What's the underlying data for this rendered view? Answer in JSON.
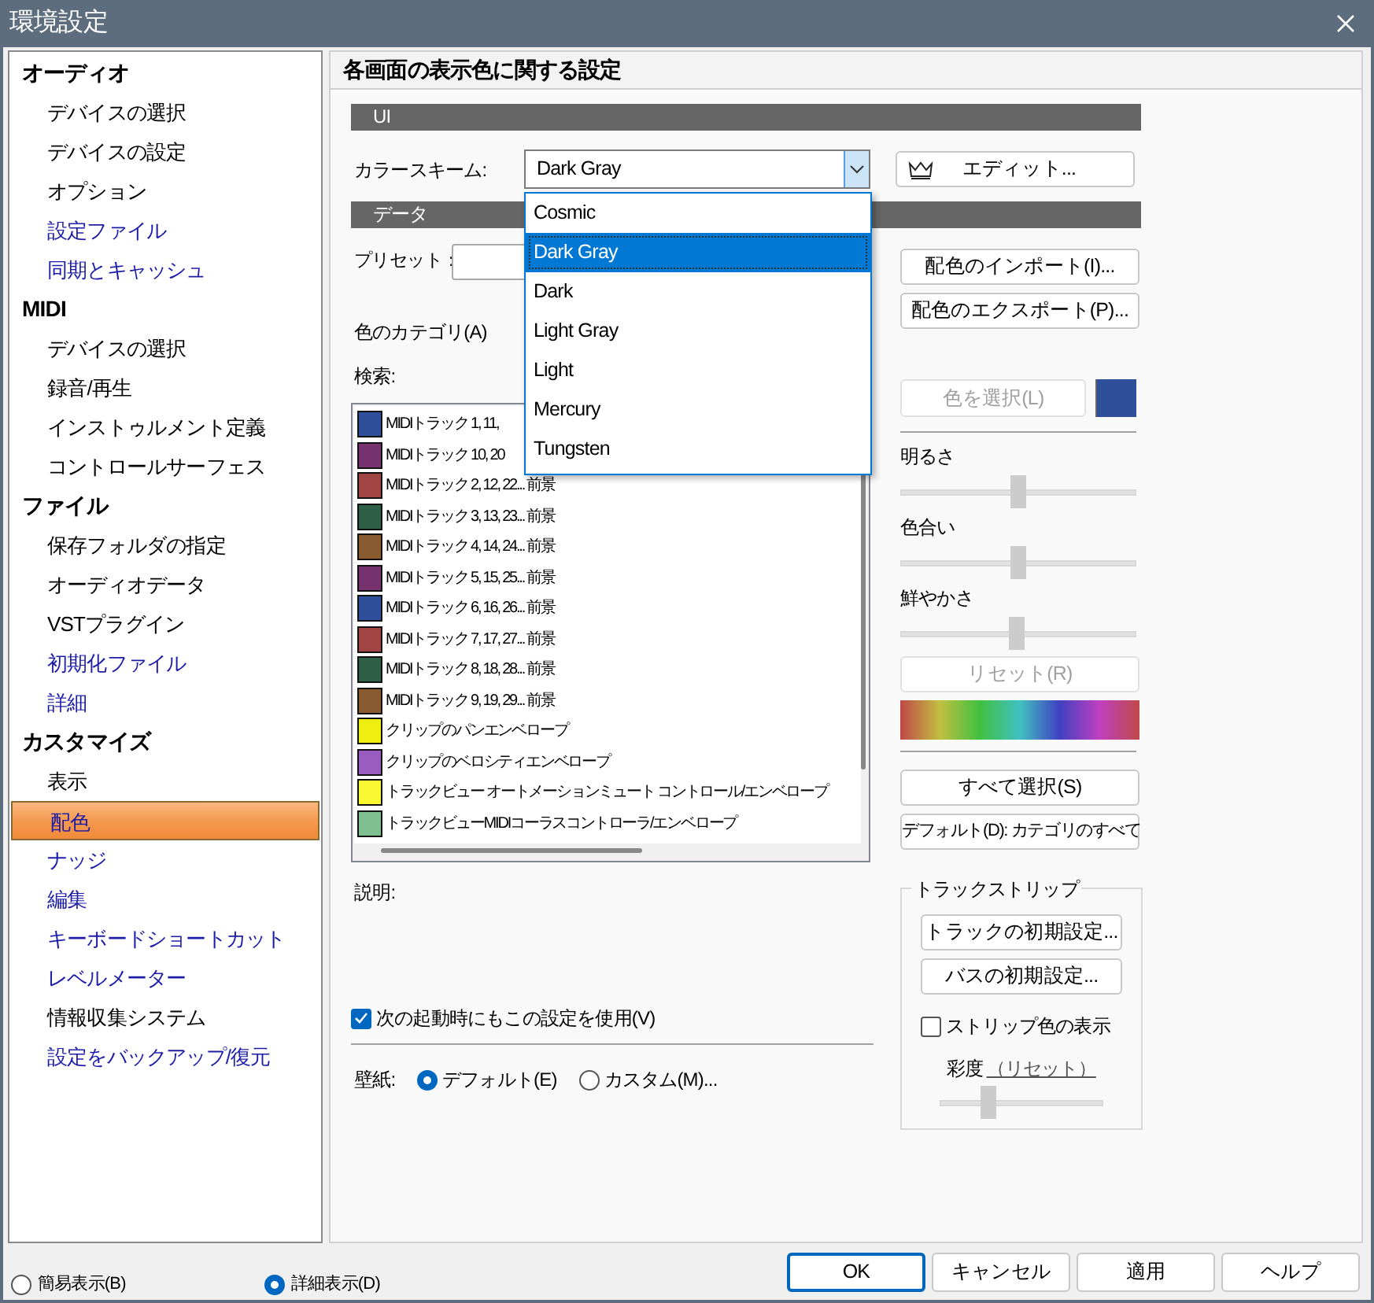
{
  "window": {
    "title": "環境設定"
  },
  "sidebar": {
    "groups": [
      {
        "label": "オーディオ",
        "items": [
          {
            "label": "デバイスの選択",
            "selected": false,
            "color": "#000000"
          },
          {
            "label": "デバイスの設定",
            "selected": false,
            "color": "#000000"
          },
          {
            "label": "オプション",
            "selected": false,
            "color": "#000000"
          },
          {
            "label": "設定ファイル",
            "selected": false,
            "color": "#1c1ca8"
          },
          {
            "label": "同期とキャッシュ",
            "selected": false,
            "color": "#1c1ca8"
          }
        ]
      },
      {
        "label": "MIDI",
        "items": [
          {
            "label": "デバイスの選択",
            "selected": false,
            "color": "#000000"
          },
          {
            "label": "録音/再生",
            "selected": false,
            "color": "#000000"
          },
          {
            "label": "インストゥルメント定義",
            "selected": false,
            "color": "#000000"
          },
          {
            "label": "コントロールサーフェス",
            "selected": false,
            "color": "#000000"
          }
        ]
      },
      {
        "label": "ファイル",
        "items": [
          {
            "label": "保存フォルダの指定",
            "selected": false,
            "color": "#000000"
          },
          {
            "label": "オーディオデータ",
            "selected": false,
            "color": "#000000"
          },
          {
            "label": "VSTプラグイン",
            "selected": false,
            "color": "#000000"
          },
          {
            "label": "初期化ファイル",
            "selected": false,
            "color": "#1c1ca8"
          },
          {
            "label": "詳細",
            "selected": false,
            "color": "#1c1ca8"
          }
        ]
      },
      {
        "label": "カスタマイズ",
        "items": [
          {
            "label": "表示",
            "selected": false,
            "color": "#000000"
          },
          {
            "label": "配色",
            "selected": true,
            "color": "#1c1ca8"
          },
          {
            "label": "ナッジ",
            "selected": false,
            "color": "#1c1ca8"
          },
          {
            "label": "編集",
            "selected": false,
            "color": "#1c1ca8"
          },
          {
            "label": "キーボードショートカット",
            "selected": false,
            "color": "#1c1ca8"
          },
          {
            "label": "レベルメーター",
            "selected": false,
            "color": "#1c1ca8"
          },
          {
            "label": "情報収集システム",
            "selected": false,
            "color": "#000000"
          },
          {
            "label": "設定をバックアップ/復元",
            "selected": false,
            "color": "#1c1ca8"
          }
        ]
      }
    ]
  },
  "panel": {
    "title": "各画面の表示色に関する設定",
    "ui_section": {
      "title": "UI",
      "color_scheme": {
        "label": "カラースキーム:",
        "value": "Dark Gray",
        "expanded": true,
        "options": [
          {
            "label": "Cosmic",
            "selected": false
          },
          {
            "label": "Dark Gray",
            "selected": true
          },
          {
            "label": "Dark",
            "selected": false
          },
          {
            "label": "Light Gray",
            "selected": false
          },
          {
            "label": "Light",
            "selected": false
          },
          {
            "label": "Mercury",
            "selected": false
          },
          {
            "label": "Tungsten",
            "selected": false
          }
        ]
      },
      "edit_button": "エディット..."
    },
    "data_section": {
      "title": "データ",
      "preset_label": "プリセット：",
      "import_button": "配色のインポート(I)...",
      "export_button": "配色のエクスポート(P)...",
      "category_label": "色のカテゴリ(A)",
      "search_label": "検索:",
      "color_items": [
        {
          "label": "MIDIトラック 1, 11,",
          "color": "#2f4f9a"
        },
        {
          "label": "MIDIトラック 10, 20",
          "color": "#773370"
        },
        {
          "label": "MIDIトラック 2, 12, 22... 前景",
          "color": "#a04444"
        },
        {
          "label": "MIDIトラック 3, 13, 23... 前景",
          "color": "#2e6048"
        },
        {
          "label": "MIDIトラック 4, 14, 24... 前景",
          "color": "#8a5a30"
        },
        {
          "label": "MIDIトラック 5, 15, 25... 前景",
          "color": "#773370"
        },
        {
          "label": "MIDIトラック 6, 16, 26... 前景",
          "color": "#2f4f9a"
        },
        {
          "label": "MIDIトラック 7, 17, 27... 前景",
          "color": "#a04444"
        },
        {
          "label": "MIDIトラック 8, 18, 28... 前景",
          "color": "#2e6048"
        },
        {
          "label": "MIDIトラック 9, 19, 29... 前景",
          "color": "#8a5a30"
        },
        {
          "label": "クリップのパンエンベロープ",
          "color": "#eeee10"
        },
        {
          "label": "クリップのベロシティエンベロープ",
          "color": "#9a5cc0"
        },
        {
          "label": "トラックビュー オートメーションミュート コントロール/エンベロープ",
          "color": "#f8f830"
        },
        {
          "label": "トラックビューMIDIコーラスコントローラ/エンベロープ",
          "color": "#80c090"
        }
      ],
      "pick_color_button": {
        "label": "色を選択(L)",
        "disabled": true
      },
      "adjustments": [
        {
          "label": "明るさ",
          "level": 0.5
        },
        {
          "label": "色合い",
          "level": 0.5
        },
        {
          "label": "鮮やかさ",
          "level": 0.49
        }
      ],
      "reset_button": {
        "label": "リセット(R)",
        "disabled": true
      },
      "select_all_button": "すべて選択(S)",
      "default_button": "デフォルト(D): カテゴリのすべて",
      "description_label": "説明:",
      "use_on_startup": {
        "label": "次の起動時にもこの設定を使用(V)",
        "checked": true
      },
      "wallpaper": {
        "label": "壁紙:",
        "options": [
          {
            "label": "デフォルト(E)",
            "selected": true
          },
          {
            "label": "カスタム(M)...",
            "selected": false
          }
        ]
      },
      "track_strip": {
        "title": "トラックストリップ",
        "buttons": [
          "トラックの初期設定...",
          "バスの初期設定..."
        ],
        "show_strip_color": {
          "label": "ストリップ色の表示",
          "checked": false
        },
        "saturation_label": "彩度",
        "saturation_reset": "（リセット）",
        "saturation": {
          "level": 0.3
        }
      }
    }
  },
  "footer": {
    "view_modes": [
      {
        "label": "簡易表示(B)",
        "selected": false
      },
      {
        "label": "詳細表示(D)",
        "selected": true
      }
    ],
    "buttons": [
      {
        "label": "OK",
        "default": true
      },
      {
        "label": "キャンセル",
        "default": false
      },
      {
        "label": "適用",
        "default": false
      },
      {
        "label": "ヘルプ",
        "default": false
      }
    ]
  }
}
